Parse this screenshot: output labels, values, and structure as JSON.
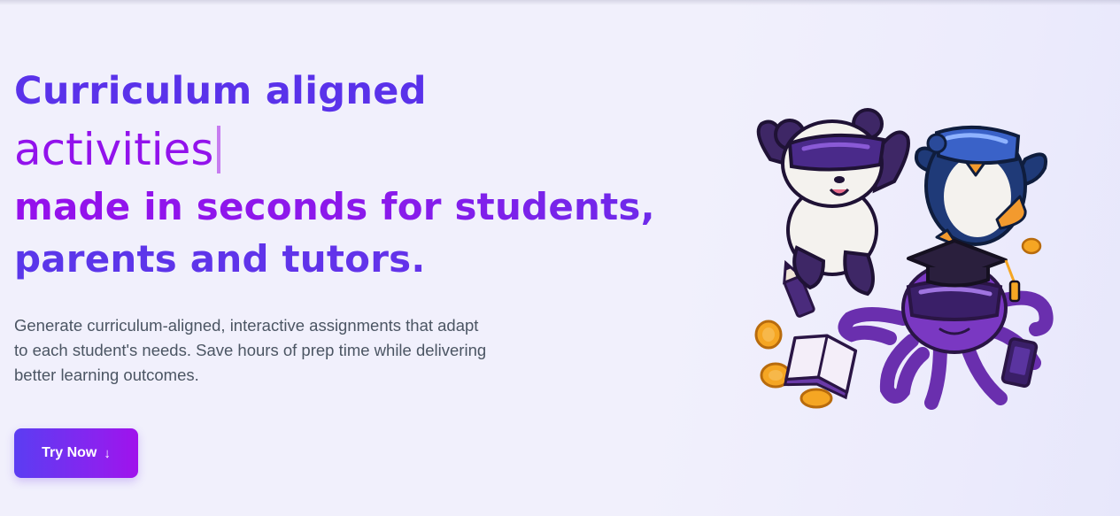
{
  "hero": {
    "headline_line1": "Curriculum aligned",
    "headline_typed": "activities",
    "headline_line3": "made in seconds for students,",
    "headline_line4": "parents and tutors.",
    "subtitle": "Generate curriculum-aligned, interactive assignments that adapt to each student's needs. Save hours of prep time while delivering better learning outcomes.",
    "cta_label": "Try Now",
    "cta_icon": "arrow-down-icon"
  },
  "illustration": {
    "characters": [
      "panda-icon",
      "penguin-icon",
      "octopus-icon"
    ],
    "props": [
      "graduation-cap-icon",
      "pencil-icon",
      "book-icon",
      "tablet-icon",
      "coin-icon"
    ]
  },
  "colors": {
    "brand_indigo": "#5a32ea",
    "brand_purple": "#9212ec",
    "cursor": "#c77cf0",
    "text_muted": "#4b5563",
    "background": "#f1f0fc"
  }
}
